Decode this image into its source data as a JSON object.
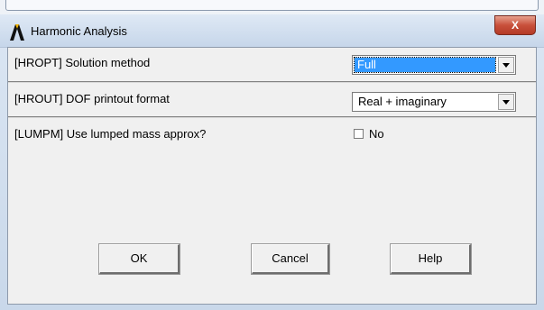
{
  "window": {
    "title": "Harmonic Analysis",
    "close_glyph": "X"
  },
  "fields": {
    "solution_method": {
      "label": "[HROPT]  Solution method",
      "value": "Full"
    },
    "dof_printout": {
      "label": "[HROUT]  DOF printout format",
      "value": "Real + imaginary"
    },
    "lumped_mass": {
      "label": "[LUMPM]  Use lumped mass approx?",
      "checkbox_label": "No",
      "checked": false
    }
  },
  "buttons": {
    "ok": "OK",
    "cancel": "Cancel",
    "help": "Help"
  },
  "icons": {
    "logo": "ansys-logo-icon",
    "close": "close-icon",
    "dropdown": "chevron-down-icon"
  }
}
